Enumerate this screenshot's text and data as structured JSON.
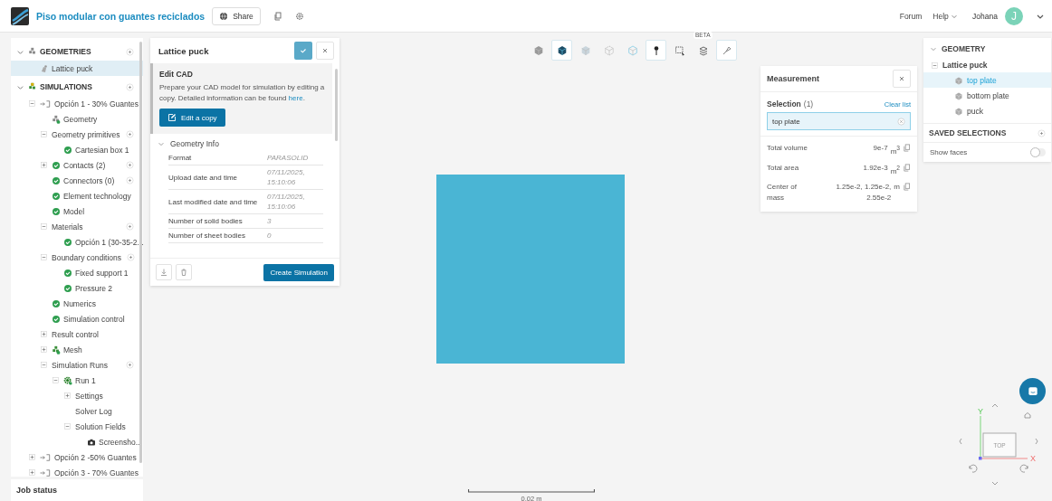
{
  "header": {
    "title": "Piso modular con guantes reciclados",
    "share": "Share",
    "links": [
      "Forum",
      "Help"
    ],
    "user": "Johana",
    "avatar": "J"
  },
  "sidebar": {
    "tree": [
      {
        "label": "GEOMETRIES",
        "kind": "section-geometry",
        "selected": false,
        "expanded": true,
        "addable": true,
        "children": [
          {
            "label": "Lattice puck",
            "kind": "part",
            "selected": true
          }
        ]
      },
      {
        "label": "SIMULATIONS",
        "kind": "section-simulation",
        "selected": false,
        "expanded": true,
        "addable": true,
        "children": [
          {
            "label": "Opción 1 - 30% Guantes",
            "kind": "option",
            "selected": false,
            "expanded": true,
            "children": [
              {
                "label": "Geometry",
                "kind": "geometry",
                "selected": false
              },
              {
                "label": "Geometry primitives",
                "kind": "plain",
                "selected": false,
                "expanded": true,
                "addable": true,
                "children": [
                  {
                    "label": "Cartesian box 1",
                    "kind": "ok",
                    "selected": false
                  }
                ]
              },
              {
                "label": "Contacts (2)",
                "kind": "ok",
                "selected": false,
                "expanded": false,
                "addable": true
              },
              {
                "label": "Connectors (0)",
                "kind": "ok",
                "selected": false,
                "addable": true
              },
              {
                "label": "Element technology",
                "kind": "ok",
                "selected": false
              },
              {
                "label": "Model",
                "kind": "ok",
                "selected": false
              },
              {
                "label": "Materials",
                "kind": "plain",
                "selected": false,
                "expanded": true,
                "addable": true,
                "children": [
                  {
                    "label": "Opción 1 (30-35-2...",
                    "kind": "ok",
                    "selected": false
                  }
                ]
              },
              {
                "label": "Boundary conditions",
                "kind": "plain",
                "selected": false,
                "expanded": true,
                "addable": true,
                "children": [
                  {
                    "label": "Fixed support 1",
                    "kind": "ok",
                    "selected": false
                  },
                  {
                    "label": "Pressure 2",
                    "kind": "ok",
                    "selected": false
                  }
                ]
              },
              {
                "label": "Numerics",
                "kind": "ok",
                "selected": false
              },
              {
                "label": "Simulation control",
                "kind": "ok",
                "selected": false
              },
              {
                "label": "Result control",
                "kind": "plain",
                "selected": false,
                "expanded": false
              },
              {
                "label": "Mesh",
                "kind": "mesh",
                "selected": false,
                "expanded": false
              },
              {
                "label": "Simulation Runs",
                "kind": "plain",
                "selected": false,
                "expanded": true,
                "addable": true,
                "children": [
                  {
                    "label": "Run 1",
                    "kind": "run",
                    "selected": false,
                    "expanded": true,
                    "children": [
                      {
                        "label": "Settings",
                        "kind": "plain",
                        "selected": false,
                        "expanded": false
                      },
                      {
                        "label": "Solver Log",
                        "kind": "plain",
                        "selected": false
                      },
                      {
                        "label": "Solution Fields",
                        "kind": "plain",
                        "selected": false,
                        "expanded": true,
                        "children": [
                          {
                            "label": "Screensho...",
                            "kind": "camera",
                            "selected": false
                          }
                        ]
                      }
                    ]
                  }
                ]
              }
            ]
          },
          {
            "label": "Opción 2 -50% Guantes",
            "kind": "option",
            "selected": false,
            "expanded": false
          },
          {
            "label": "Opción 3 - 70% Guantes",
            "kind": "option",
            "selected": false,
            "expanded": false
          }
        ]
      }
    ],
    "job_status": "Job status"
  },
  "edit_panel": {
    "title": "Lattice puck",
    "section_title": "Edit CAD",
    "description": "Prepare your CAD model for simulation by editing a copy. Detailed information can be found ",
    "link": "here",
    "description_end": ".",
    "edit_button": "Edit a copy",
    "info_title": "Geometry Info",
    "info_expanded": true,
    "info": [
      {
        "label": "Format",
        "value": "PARASOLID"
      },
      {
        "label": "Upload date and time",
        "value": "07/11/2025, 15:10:06"
      },
      {
        "label": "Last modified date and time",
        "value": "07/11/2025, 15:10:06"
      },
      {
        "label": "Number of solid bodies",
        "value": "3"
      },
      {
        "label": "Number of sheet bodies",
        "value": "0"
      }
    ],
    "create_button": "Create Simulation"
  },
  "toolbar": [
    {
      "kind": "cube-solid",
      "selected": false
    },
    {
      "kind": "cube-dark",
      "selected": true
    },
    {
      "kind": "cube-light",
      "selected": false
    },
    {
      "kind": "cube-dotted",
      "selected": false
    },
    {
      "kind": "cube-outline",
      "selected": false
    },
    {
      "kind": "pin",
      "selected": true
    },
    {
      "kind": "box-select",
      "selected": false
    },
    {
      "kind": "layers",
      "selected": false,
      "badge": "BETA"
    },
    {
      "kind": "probe",
      "selected": true
    }
  ],
  "measurement": {
    "title": "Measurement",
    "selection_label": "Selection",
    "selection_count": "(1)",
    "clear": "Clear list",
    "selected_item": "top plate",
    "rows": [
      {
        "label": "Total volume",
        "value": "9e-7",
        "unit": "m$^{3}$"
      },
      {
        "label": "Total area",
        "value": "1.92e-3",
        "unit": "m$^{2}$"
      },
      {
        "label": "Center of mass",
        "value": "1.25e-2, 1.25e-2, 2.55e-2",
        "unit": "m"
      }
    ]
  },
  "geometry_panel": {
    "title": "GEOMETRY",
    "expanded": true,
    "root": {
      "label": "Lattice puck",
      "expanded": true
    },
    "parts": [
      {
        "label": "top plate",
        "selected": true
      },
      {
        "label": "bottom plate",
        "selected": false
      },
      {
        "label": "puck",
        "selected": false
      }
    ],
    "saved_selections": "SAVED SELECTIONS",
    "show_faces": {
      "label": "Show faces",
      "on": false
    }
  },
  "view_cube": {
    "face": "TOP",
    "axis_y": "Y",
    "axis_x": "X"
  },
  "scale_bar": "0.02 m"
}
